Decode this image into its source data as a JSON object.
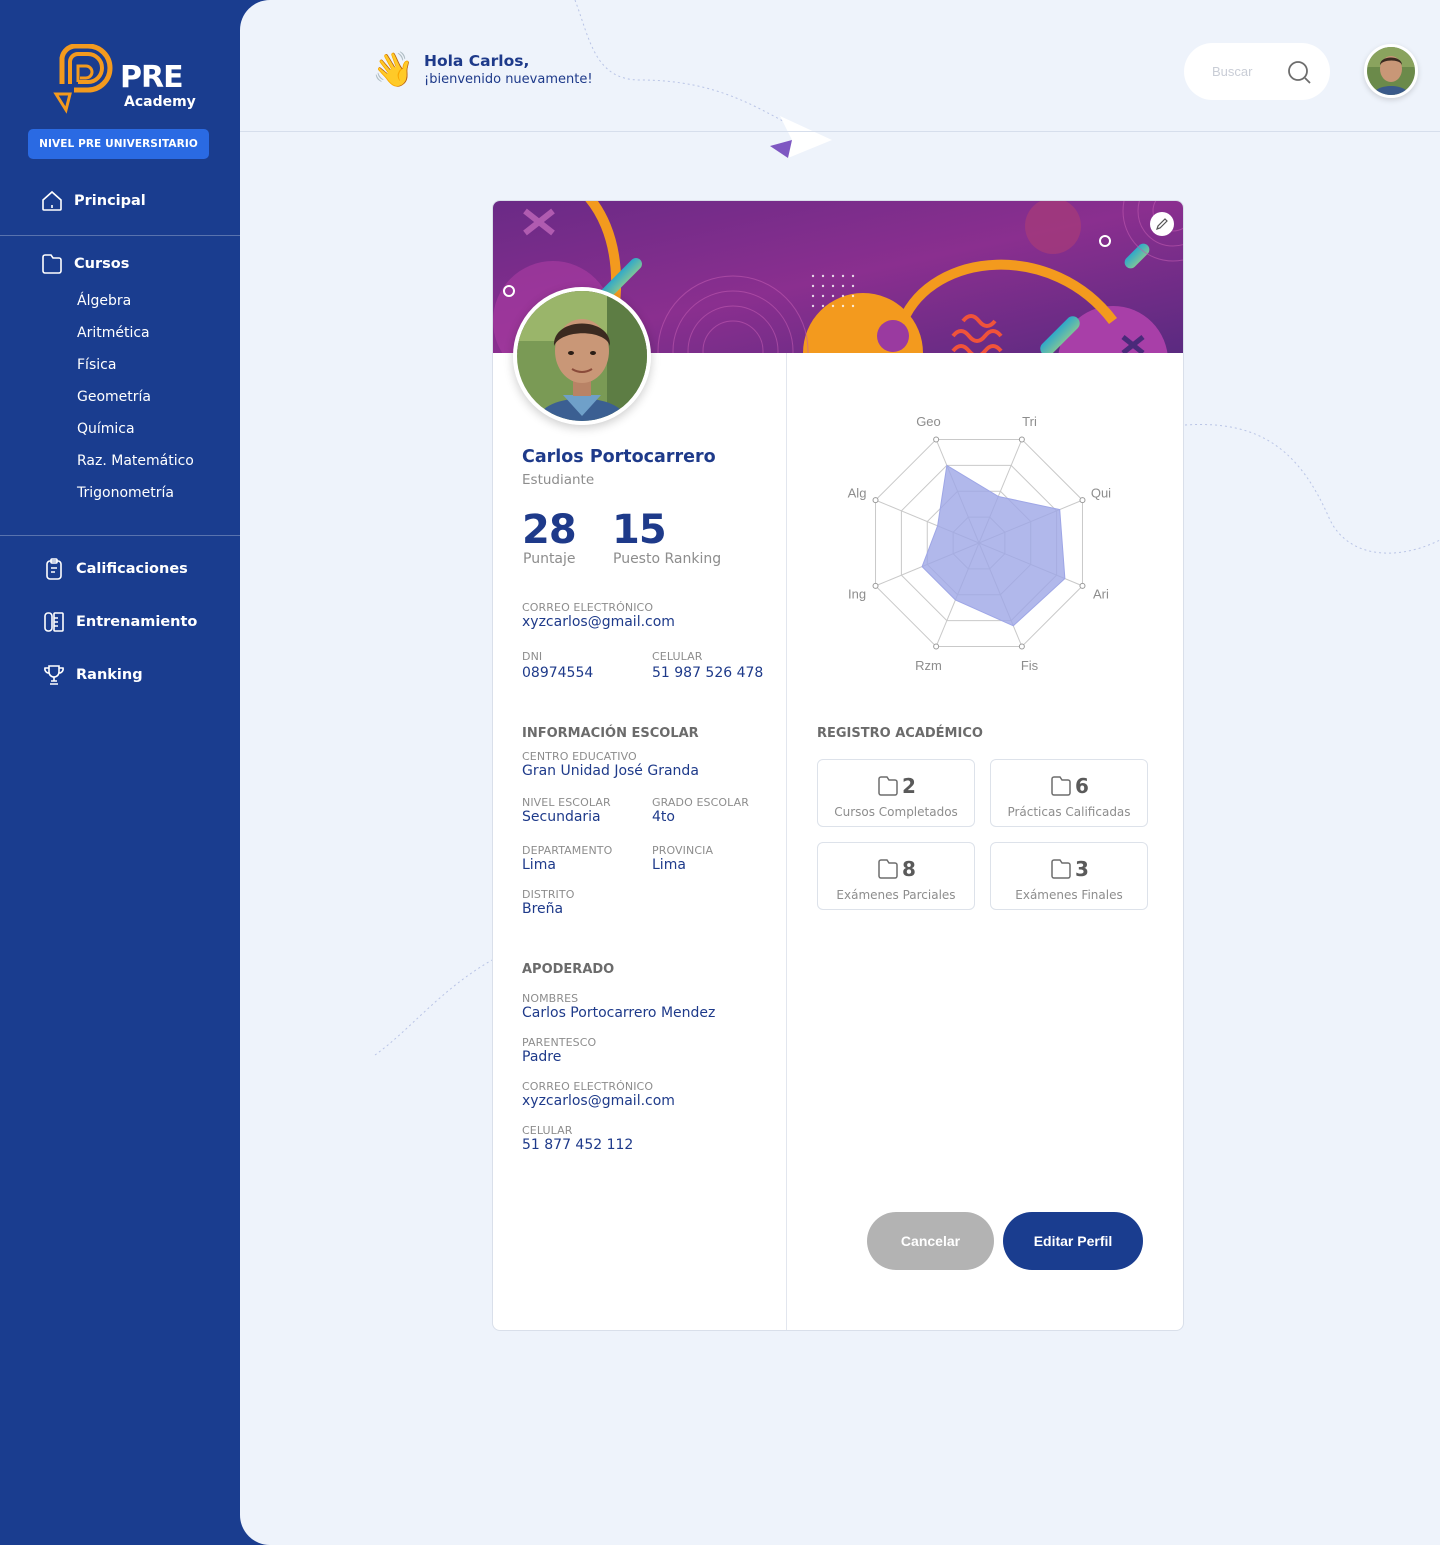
{
  "brand": {
    "name": "PRE",
    "sub": "Academy",
    "level": "NIVEL PRE UNIVERSITARIO"
  },
  "nav": {
    "principal": "Principal",
    "cursos": "Cursos",
    "courses": [
      "Álgebra",
      "Aritmética",
      "Física",
      "Geometría",
      "Química",
      "Raz. Matemático",
      "Trigonometría"
    ],
    "calificaciones": "Calificaciones",
    "entrenamiento": "Entrenamiento",
    "ranking": "Ranking"
  },
  "header": {
    "greeting": "Hola Carlos,",
    "subgreeting": "¡bienvenido nuevamente!",
    "emoji": "👋",
    "search_placeholder": "Buscar"
  },
  "profile": {
    "name": "Carlos Portocarrero",
    "role": "Estudiante",
    "score": "28",
    "score_label": "Puntaje",
    "rank": "15",
    "rank_label": "Puesto Ranking",
    "email_label": "CORREO ELECTRÓNICO",
    "email": "xyzcarlos@gmail.com",
    "dni_label": "DNI",
    "dni": "08974554",
    "phone_label": "CELULAR",
    "phone": "51 987 526 478"
  },
  "school": {
    "title": "INFORMACIÓN ESCOLAR",
    "center_label": "CENTRO EDUCATIVO",
    "center": "Gran Unidad José Granda",
    "level_label": "NIVEL ESCOLAR",
    "level": "Secundaria",
    "grade_label": "GRADO ESCOLAR",
    "grade": "4to",
    "dept_label": "DEPARTAMENTO",
    "dept": "Lima",
    "prov_label": "PROVINCIA",
    "prov": "Lima",
    "district_label": "DISTRITO",
    "district": "Breña"
  },
  "guardian": {
    "title": "APODERADO",
    "names_label": "NOMBRES",
    "names": "Carlos Portocarrero Mendez",
    "relation_label": "PARENTESCO",
    "relation": "Padre",
    "email_label": "CORREO ELECTRÓNICO",
    "email": "xyzcarlos@gmail.com",
    "phone_label": "CELULAR",
    "phone": "51 877 452 112"
  },
  "radar": {
    "axes": [
      "Geo",
      "Tri",
      "Qui",
      "Ari",
      "Fis",
      "Rzm",
      "Ing",
      "Alg"
    ],
    "values": [
      0.75,
      0.45,
      0.78,
      0.83,
      0.8,
      0.55,
      0.55,
      0.4
    ],
    "color": "#9ea6e6"
  },
  "academic": {
    "title": "REGISTRO ACADÉMICO",
    "tiles": [
      {
        "value": "2",
        "label": "Cursos Completados"
      },
      {
        "value": "6",
        "label": "Prácticas Calificadas"
      },
      {
        "value": "8",
        "label": "Exámenes Parciales"
      },
      {
        "value": "3",
        "label": "Exámenes Finales"
      }
    ]
  },
  "actions": {
    "cancel": "Cancelar",
    "edit": "Editar Perfil"
  },
  "colors": {
    "primary": "#1a3d8f",
    "accent": "#2a6ae3",
    "orange": "#f39a1e",
    "banner": "#7b2c8f"
  }
}
